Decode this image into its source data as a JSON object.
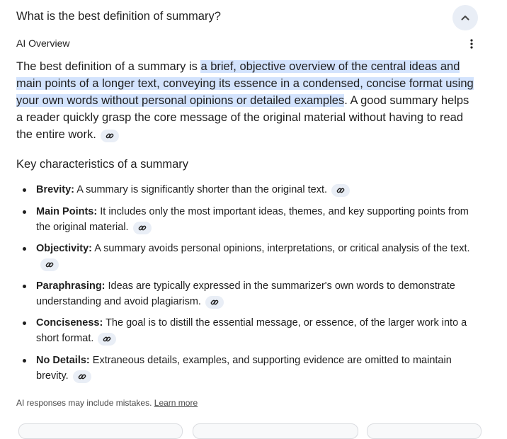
{
  "question": "What is the best definition of summary?",
  "overview_label": "AI Overview",
  "summary": {
    "lead": "The best definition of a summary is ",
    "highlight": "a brief, objective overview of the central ideas and main points of a longer text, conveying its essence in a condensed, concise format using your own words without personal opinions or detailed examples",
    "tail": ". A good summary helps a reader quickly grasp the core message of the original material without having to read the entire work."
  },
  "characteristics_heading": "Key characteristics of a summary",
  "characteristics": [
    {
      "term": "Brevity:",
      "text": " A summary is significantly shorter than the original text."
    },
    {
      "term": "Main Points:",
      "text": " It includes only the most important ideas, themes, and key supporting points from the original material."
    },
    {
      "term": "Objectivity:",
      "text": " A summary avoids personal opinions, interpretations, or critical analysis of the text."
    },
    {
      "term": "Paraphrasing:",
      "text": " Ideas are typically expressed in the summarizer's own words to demonstrate understanding and avoid plagiarism."
    },
    {
      "term": "Conciseness:",
      "text": " The goal is to distill the essential message, or essence, of the larger work into a short format."
    },
    {
      "term": "No Details:",
      "text": " Extraneous details, examples, and supporting evidence are omitted to maintain brevity."
    }
  ],
  "footer": {
    "disclaimer": "AI responses may include mistakes.",
    "learn_more": "Learn more"
  },
  "icons": {
    "collapse": "chevron-up-icon",
    "menu": "more-vert-icon",
    "source": "link-icon"
  },
  "colors": {
    "highlight": "#d3e3fd",
    "chip": "#e9eef6"
  }
}
